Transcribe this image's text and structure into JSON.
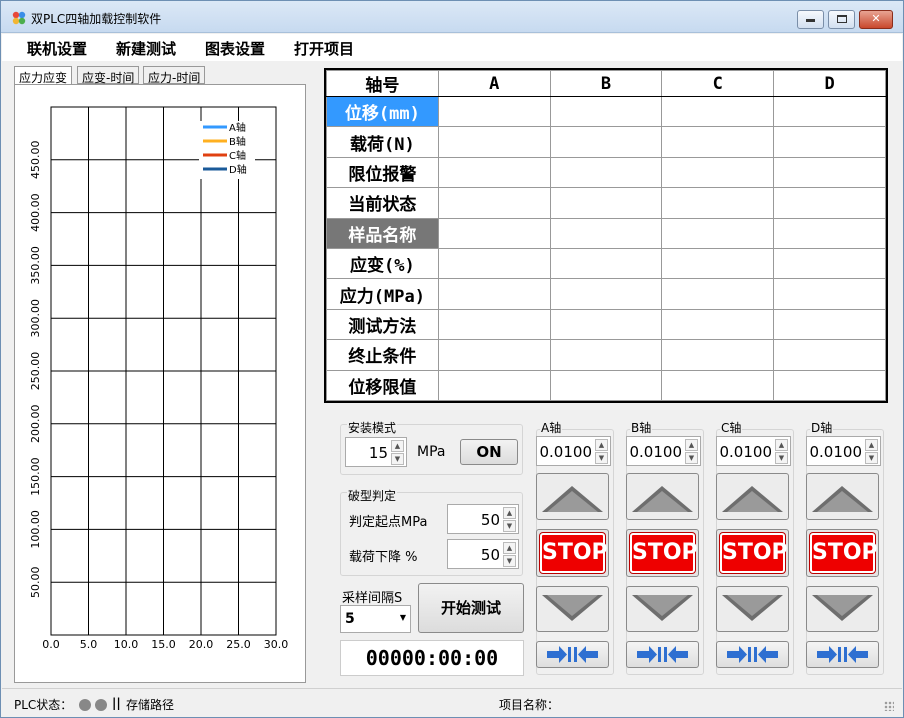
{
  "window": {
    "title": "双PLC四轴加载控制软件",
    "min_label": "—",
    "max_label": "□",
    "close_label": "✕"
  },
  "menu": [
    "联机设置",
    "新建测试",
    "图表设置",
    "打开项目"
  ],
  "chart_tabs": [
    "应力应变",
    "应变-时间",
    "应力-时间"
  ],
  "chart_data": {
    "type": "line",
    "x_ticks": [
      "0.0",
      "5.0",
      "10.0",
      "15.0",
      "20.0",
      "25.0",
      "30.0"
    ],
    "y_ticks": [
      "50.00",
      "100.00",
      "150.00",
      "200.00",
      "250.00",
      "300.00",
      "350.00",
      "400.00",
      "450.00"
    ],
    "xlim": [
      0,
      30
    ],
    "ylim": [
      0,
      500
    ],
    "grid": true,
    "legend_position": "top-right",
    "series": [
      {
        "name": "A轴",
        "color": "#3399ff",
        "values": []
      },
      {
        "name": "B轴",
        "color": "#ffb020",
        "values": []
      },
      {
        "name": "C轴",
        "color": "#e04010",
        "values": []
      },
      {
        "name": "D轴",
        "color": "#1a5a99",
        "values": []
      }
    ]
  },
  "grid": {
    "header": "轴号",
    "columns": [
      "A",
      "B",
      "C",
      "D"
    ],
    "rows": [
      "位移(mm)",
      "载荷(N)",
      "限位报警",
      "当前状态",
      "样品名称",
      "应变(%)",
      "应力(MPa)",
      "测试方法",
      "终止条件",
      "位移限值"
    ]
  },
  "install": {
    "label": "安装模式",
    "value": "15",
    "unit": "MPa",
    "on_label": "ON"
  },
  "break": {
    "label": "破型判定",
    "start_label": "判定起点MPa",
    "start_value": "50",
    "drop_label": "载荷下降 %",
    "drop_value": "50"
  },
  "sampling": {
    "label": "采样间隔S",
    "value": "5",
    "start_button": "开始测试"
  },
  "timer": "00000:00:00",
  "axes": [
    {
      "label": "A轴",
      "value": "0.0100",
      "stop": "STOP"
    },
    {
      "label": "B轴",
      "value": "0.0100",
      "stop": "STOP"
    },
    {
      "label": "C轴",
      "value": "0.0100",
      "stop": "STOP"
    },
    {
      "label": "D轴",
      "value": "0.0100",
      "stop": "STOP"
    }
  ],
  "status": {
    "plc_label": "PLC状态：",
    "separator": "||",
    "storage_label": "存储路径",
    "project_label": "项目名称："
  },
  "colors": {
    "selected_row": "#3399ff",
    "highlight_row": "#777777",
    "stop_red": "#ee0000",
    "arrow_blue": "#2e6fd1"
  }
}
